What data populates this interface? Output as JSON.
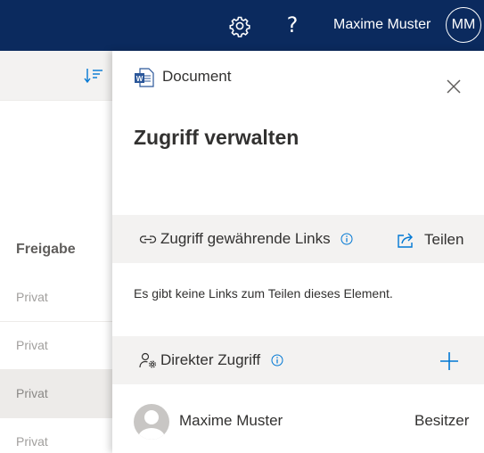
{
  "topbar": {
    "settings_icon": "gear-icon",
    "help_label": "?",
    "user_name": "Maxime Muster",
    "user_initials": "MM",
    "background_color": "#0b2a5e"
  },
  "list": {
    "column_header": "Freigabe",
    "rows": [
      {
        "label": "Privat"
      },
      {
        "label": "Privat"
      },
      {
        "label": "Privat"
      },
      {
        "label": "Privat"
      }
    ]
  },
  "panel": {
    "doc_name": "Document",
    "title": "Zugriff verwalten",
    "links_section": {
      "label": "Zugriff gewährende Links",
      "share_label": "Teilen",
      "empty_text": "Es gibt keine Links zum Teilen dieses Element."
    },
    "direct_section": {
      "label": "Direkter Zugriff"
    },
    "people": [
      {
        "name": "Maxime Muster",
        "role": "Besitzer"
      }
    ],
    "accent_color": "#0078d4"
  }
}
